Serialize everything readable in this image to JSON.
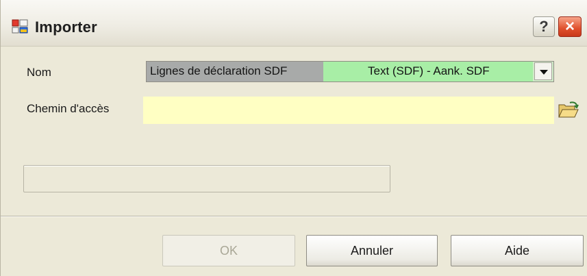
{
  "window": {
    "title": "Importer",
    "help_button_label": "?",
    "close_button_label": "×"
  },
  "form": {
    "nom_label": "Nom",
    "nom_value": "Lignes de déclaration SDF",
    "nom_type": "Text (SDF)  -  Aank. SDF",
    "chemin_label": "Chemin d'accès",
    "chemin_value": "",
    "progress": 0
  },
  "buttons": {
    "ok": "OK",
    "annuler": "Annuler",
    "aide": "Aide"
  },
  "icons": {
    "app": "importer-app-icon",
    "dropdown": "chevron-down-icon",
    "browse": "open-folder-icon"
  },
  "colors": {
    "window_bg": "#ece9d8",
    "nom_selection_gray": "#a8aaa9",
    "nom_selection_green": "#a8eea6",
    "path_field_bg": "#ffffc3",
    "close_button_red": "#e0502c"
  }
}
